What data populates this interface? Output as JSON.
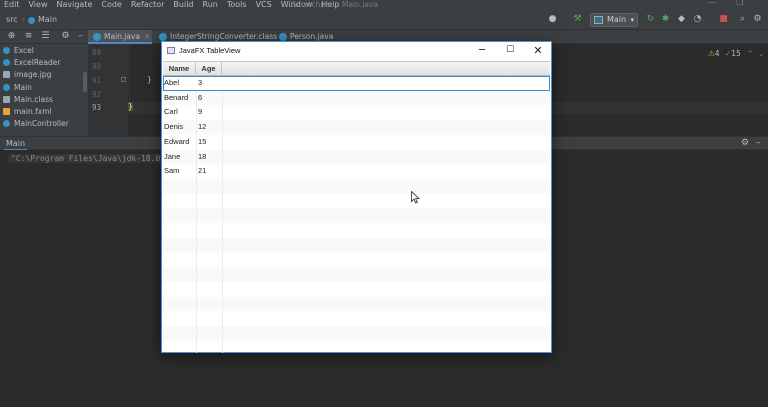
{
  "menu": [
    "Edit",
    "View",
    "Navigate",
    "Code",
    "Refactor",
    "Build",
    "Run",
    "Tools",
    "VCS",
    "Window",
    "Help"
  ],
  "window_title": "Scratchpad - Main.java",
  "breadcrumb": [
    "src",
    "Main"
  ],
  "run_config": "Main",
  "project_files": [
    {
      "label": "Excel",
      "icon": "class-icon",
      "color": "#3592c4"
    },
    {
      "label": "ExcelReader",
      "icon": "class-icon",
      "color": "#3592c4"
    },
    {
      "label": "image.jpg",
      "icon": "image-file-icon",
      "color": "#9aa7b0"
    },
    {
      "label": "Main",
      "icon": "class-icon",
      "color": "#3592c4"
    },
    {
      "label": "Main.class",
      "icon": "class-file-icon",
      "color": "#9aa7b0"
    },
    {
      "label": "main.fxml",
      "icon": "fxml-file-icon",
      "color": "#e8a33d"
    },
    {
      "label": "MainController",
      "icon": "class-icon",
      "color": "#3592c4"
    }
  ],
  "tabs": [
    {
      "label": "Main.java",
      "active": true
    },
    {
      "label": "IntegerStringConverter.class",
      "active": false
    },
    {
      "label": "Person.java",
      "active": false
    }
  ],
  "line_numbers": [
    "89",
    "90",
    "91",
    "92",
    "93"
  ],
  "code": {
    "brace_close": "}",
    "caret_brace": "}"
  },
  "inspections": {
    "warnings": "4",
    "ok": "15"
  },
  "run_panel": {
    "tab": "Main",
    "command": "\"C:\\Program Files\\Java\\jdk-18.0"
  },
  "fx_window": {
    "title": "JavaFX TableView",
    "columns": [
      "Name",
      "Age"
    ],
    "rows": [
      {
        "name": "Abel",
        "age": "3"
      },
      {
        "name": "Benard",
        "age": "6"
      },
      {
        "name": "Carl",
        "age": "9"
      },
      {
        "name": "Denis",
        "age": "12"
      },
      {
        "name": "Edward",
        "age": "15"
      },
      {
        "name": "Jane",
        "age": "18"
      },
      {
        "name": "Sam",
        "age": "21"
      }
    ],
    "selected_row": 0
  }
}
